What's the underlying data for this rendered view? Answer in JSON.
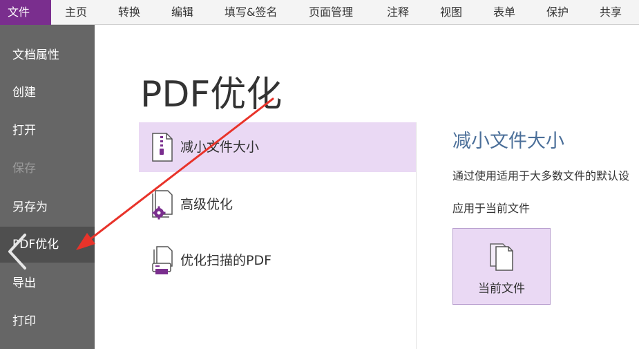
{
  "menubar": {
    "tabs": [
      {
        "label": "文件",
        "active": true
      },
      {
        "label": "主页"
      },
      {
        "label": "转换"
      },
      {
        "label": "编辑"
      },
      {
        "label": "填写&签名"
      },
      {
        "label": "页面管理"
      },
      {
        "label": "注释"
      },
      {
        "label": "视图"
      },
      {
        "label": "表单"
      },
      {
        "label": "保护"
      },
      {
        "label": "共享"
      }
    ]
  },
  "sidebar": {
    "items": [
      {
        "label": "文档属性"
      },
      {
        "label": "创建"
      },
      {
        "label": "打开"
      },
      {
        "label": "保存",
        "disabled": true
      },
      {
        "label": "另存为"
      },
      {
        "label": "PDF优化",
        "selected": true
      },
      {
        "label": "导出"
      },
      {
        "label": "打印"
      }
    ]
  },
  "main": {
    "title": "PDF优化",
    "options": [
      {
        "label": "减小文件大小",
        "icon": "zip-file-icon",
        "selected": true
      },
      {
        "label": "高级优化",
        "icon": "file-gear-icon"
      },
      {
        "label": "优化扫描的PDF",
        "icon": "file-scan-icon"
      }
    ],
    "detail": {
      "title": "减小文件大小",
      "description": "通过使用适用于大多数文件的默认设",
      "apply_label": "应用于当前文件",
      "current_button": "当前文件"
    }
  },
  "colors": {
    "accent": "#7a2e8e",
    "selected_bg": "#ead9f4",
    "sidebar_bg": "#666666",
    "detail_title": "#4b6f99",
    "annotation_arrow": "#e8332a"
  }
}
